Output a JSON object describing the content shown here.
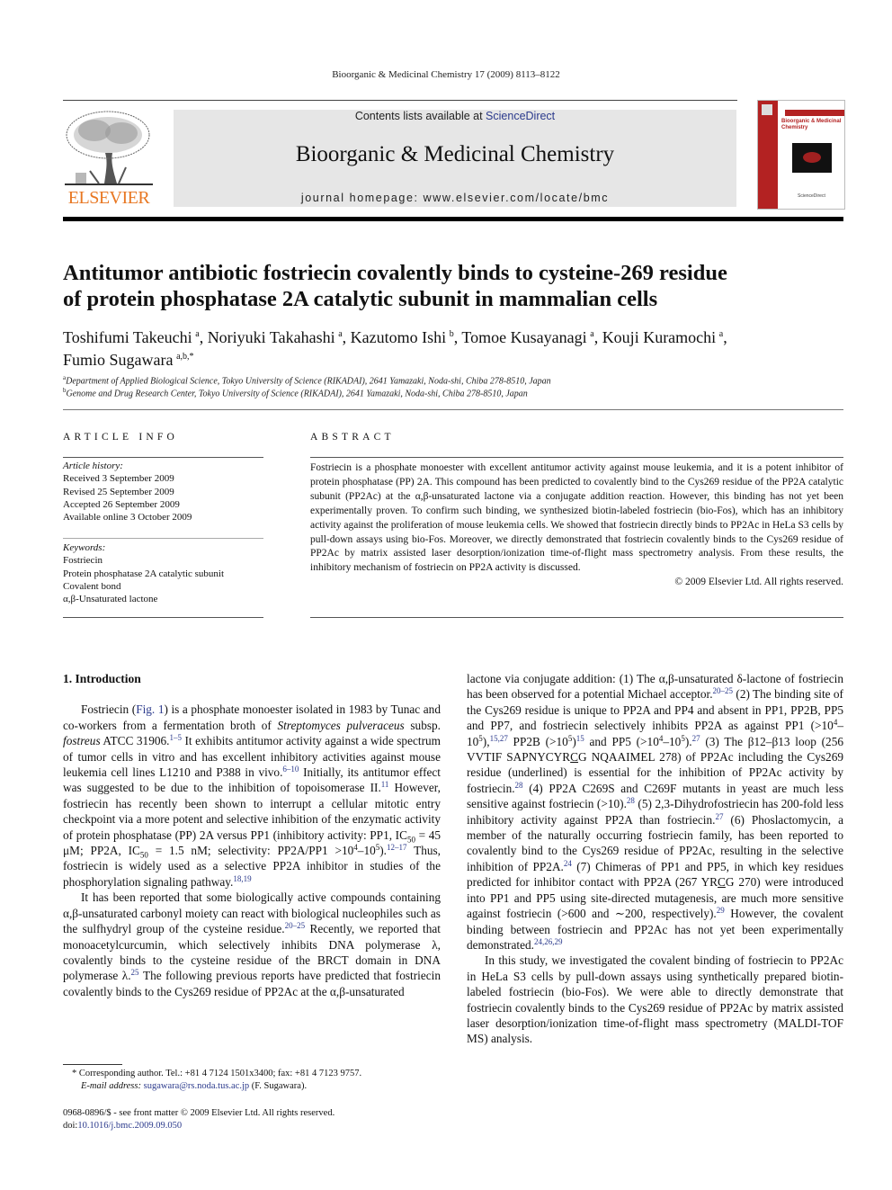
{
  "running_head": "Bioorganic & Medicinal Chemistry 17 (2009) 8113–8122",
  "masthead": {
    "publisher_logo": "ELSEVIER",
    "contents_prefix": "Contents lists available at ",
    "contents_link": "ScienceDirect",
    "journal_title": "Bioorganic & Medicinal Chemistry",
    "homepage": "journal homepage: www.elsevier.com/locate/bmc",
    "cover_title": "Bioorganic & Medicinal Chemistry",
    "cover_footer": "ScienceDirect",
    "colors": {
      "accent": "#b32222",
      "logo": "#e87722",
      "banner": "#e6e6e6",
      "link": "#2b3a8c"
    }
  },
  "article": {
    "title_line1": "Antitumor antibiotic fostriecin covalently binds to cysteine-269 residue",
    "title_line2": "of protein phosphatase 2A catalytic subunit in mammalian cells",
    "authors": [
      {
        "name": "Toshifumi Takeuchi",
        "aff": "a",
        "sep": ", "
      },
      {
        "name": "Noriyuki Takahashi",
        "aff": "a",
        "sep": ", "
      },
      {
        "name": "Kazutomo Ishi",
        "aff": "b",
        "sep": ", "
      },
      {
        "name": "Tomoe Kusayanagi",
        "aff": "a",
        "sep": ", "
      },
      {
        "name": "Kouji Kuramochi",
        "aff": "a",
        "sep": ", "
      },
      {
        "name": "Fumio Sugawara",
        "aff": "a,b,*",
        "sep": ""
      }
    ],
    "affiliations": [
      {
        "key": "a",
        "text": "Department of Applied Biological Science, Tokyo University of Science (RIKADAI), 2641 Yamazaki, Noda-shi, Chiba 278-8510, Japan"
      },
      {
        "key": "b",
        "text": "Genome and Drug Research Center, Tokyo University of Science (RIKADAI), 2641 Yamazaki, Noda-shi, Chiba 278-8510, Japan"
      }
    ]
  },
  "article_info": {
    "heading": "ARTICLE INFO",
    "history_label": "Article history:",
    "history": [
      "Received 3 September 2009",
      "Revised 25 September 2009",
      "Accepted 26 September 2009",
      "Available online 3 October 2009"
    ],
    "keywords_label": "Keywords:",
    "keywords": [
      "Fostriecin",
      "Protein phosphatase 2A catalytic subunit",
      "Covalent bond",
      "α,β-Unsaturated lactone"
    ]
  },
  "abstract": {
    "heading": "ABSTRACT",
    "text": "Fostriecin is a phosphate monoester with excellent antitumor activity against mouse leukemia, and it is a potent inhibitor of protein phosphatase (PP) 2A. This compound has been predicted to covalently bind to the Cys269 residue of the PP2A catalytic subunit (PP2Ac) at the α,β-unsaturated lactone via a conjugate addition reaction. However, this binding has not yet been experimentally proven. To confirm such binding, we synthesized biotin-labeled fostriecin (bio-Fos), which has an inhibitory activity against the proliferation of mouse leukemia cells. We showed that fostriecin directly binds to PP2Ac in HeLa S3 cells by pull-down assays using bio-Fos. Moreover, we directly demonstrated that fostriecin covalently binds to the Cys269 residue of PP2Ac by matrix assisted laser desorption/ionization time-of-flight mass spectrometry analysis. From these results, the inhibitory mechanism of fostriecin on PP2A activity is discussed.",
    "copyright": "© 2009 Elsevier Ltd. All rights reserved."
  },
  "body": {
    "section_heading": "1.  Introduction",
    "p1": {
      "a": "Fostriecin (",
      "fig_link": "Fig. 1",
      "b": ") is a phosphate monoester isolated in 1983 by Tunac and co-workers from a fermentation broth of ",
      "species": "Streptomyces pulveraceus",
      "c": " subsp. ",
      "subsp": "fostreus",
      "d": " ATCC 31906.",
      "r1": "1–5",
      "e": " It exhibits antitumor activity against a wide spectrum of tumor cells in vitro and has excellent inhibitory activities against mouse leukemia cell lines L1210 and P388 in vivo.",
      "r2": "6–10",
      "f": " Initially, its antitumor effect was suggested to be due to the inhibition of topoisomerase II.",
      "r3": "11",
      "g": " However, fostriecin has recently been shown to interrupt a cellular mitotic entry checkpoint via a more potent and selective inhibition of the enzymatic activity of protein phosphatase (PP) 2A versus PP1 (inhibitory activity: PP1, IC",
      "sub1": "50",
      "h": " = 45 μM; PP2A, IC",
      "sub2": "50",
      "i": " = 1.5 nM; selectivity: PP2A/PP1 >10",
      "sup_a": "4",
      "j": "–10",
      "sup_b": "5",
      "k": ").",
      "r4": "12–17",
      "l": " Thus, fostriecin is widely used as a selective PP2A inhibitor in studies of the phosphorylation signaling pathway.",
      "r5": "18,19"
    },
    "p2": {
      "a": "It has been reported that some biologically active compounds containing α,β-unsaturated carbonyl moiety can react with biological nucleophiles such as the sulfhydryl group of the cysteine residue.",
      "r1": "20–25",
      "b": " Recently, we reported that monoacetylcurcumin, which selectively inhibits DNA polymerase λ, covalently binds to the cysteine residue of the BRCT domain in DNA polymerase λ.",
      "r2": "25",
      "c": " The following previous reports have predicted that fostriecin covalently binds to the Cys269 residue of PP2Ac at the α,β-unsaturated lactone via conjugate addition: (1) The α,β-unsaturated δ-lactone of fostriecin has been observed for a potential Michael acceptor.",
      "r3": "20–25",
      "d": " (2) The binding site of the Cys269 residue is unique to PP2A and PP4 and absent in PP1, PP2B, PP5 and PP7, and fostriecin selectively inhibits PP2A as against PP1 (>10",
      "s1": "4",
      "e": "–10",
      "s2": "5",
      "f": "),",
      "r4": "15,27",
      "g": " PP2B (>10",
      "s3": "5",
      "h": ")",
      "r5": "15",
      "i": " and PP5 (>10",
      "s4": "4",
      "j": "–10",
      "s5": "5",
      "k": ").",
      "r6": "27",
      "l": " (3) The β12–β13 loop (256 VVTIF SAPNYCYR",
      "u1": "C",
      "m": "G NQAAIMEL 278) of PP2Ac including the Cys269 residue (underlined) is essential for the inhibition of PP2Ac activity by fostriecin.",
      "r7": "28",
      "n": " (4) PP2A C269S and C269F mutants in yeast are much less sensitive against fostriecin (>10).",
      "r8": "28",
      "o": " (5) 2,3-Dihydrofostriecin has 200-fold less inhibitory activity against PP2A than fostriecin.",
      "r9": "27",
      "p": " (6) Phoslactomycin, a member of the naturally occurring fostriecin family, has been reported to covalently bind to the Cys269 residue of PP2Ac, resulting in the selective inhibition of PP2A.",
      "r10": "24",
      "q": " (7) Chimeras of PP1 and PP5, in which key residues predicted for inhibitor contact with PP2A (267 YR",
      "u2": "C",
      "r": "G 270) were introduced into PP1 and PP5 using site-directed mutagenesis, are much more sensitive against fostriecin (>600 and ∼200, respectively).",
      "r11": "29",
      "s": " However, the covalent binding between fostriecin and PP2Ac has not yet been experimentally demonstrated.",
      "r12": "24,26,29"
    },
    "p3": "In this study, we investigated the covalent binding of fostriecin to PP2Ac in HeLa S3 cells by pull-down assays using synthetically prepared biotin-labeled fostriecin (bio-Fos). We were able to directly demonstrate that fostriecin covalently binds to the Cys269 residue of PP2Ac by matrix assisted laser desorption/ionization time-of-flight mass spectrometry (MALDI-TOF MS) analysis."
  },
  "footnote": {
    "marker": "*",
    "text": "Corresponding author. Tel.: +81 4 7124 1501x3400; fax: +81 4 7123 9757.",
    "email_label": "E-mail address:",
    "email": "sugawara@rs.noda.tus.ac.jp",
    "email_suffix": " (F. Sugawara)."
  },
  "bottom": {
    "issn": "0968-0896/$ - see front matter © 2009 Elsevier Ltd. All rights reserved.",
    "doi_label": "doi:",
    "doi": "10.1016/j.bmc.2009.09.050"
  }
}
